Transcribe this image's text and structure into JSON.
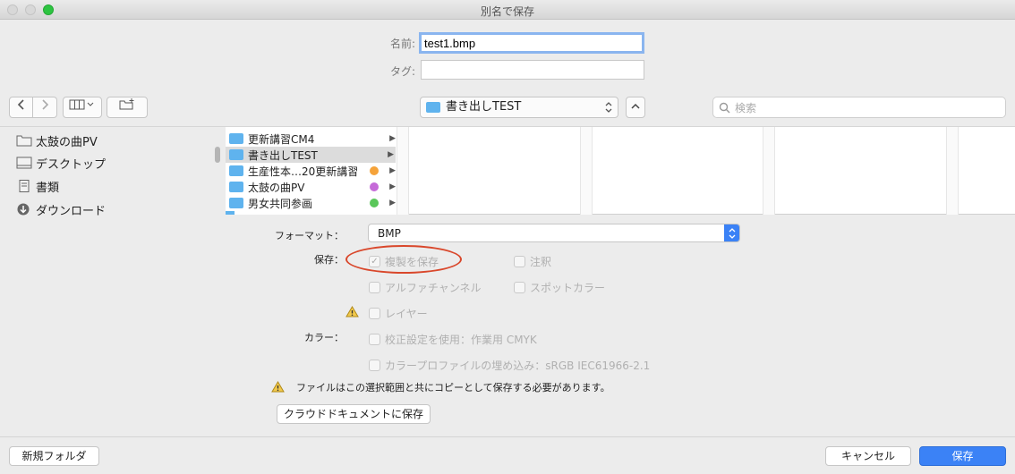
{
  "window": {
    "title": "別名で保存"
  },
  "form": {
    "name_label": "名前:",
    "name_value": "test1.bmp",
    "tag_label": "タグ:",
    "tag_value": ""
  },
  "toolbar": {
    "location": "書き出しTEST",
    "search_placeholder": "検索"
  },
  "sidebar": {
    "items": [
      {
        "label": "太鼓の曲PV",
        "icon": "folder-icon"
      },
      {
        "label": "デスクトップ",
        "icon": "desktop-icon"
      },
      {
        "label": "書類",
        "icon": "document-icon"
      },
      {
        "label": "ダウンロード",
        "icon": "download-icon"
      }
    ]
  },
  "column1": {
    "rows": [
      {
        "label": "更新講習CM4",
        "tag": null,
        "selected": false
      },
      {
        "label": "書き出しTEST",
        "tag": null,
        "selected": true
      },
      {
        "label": "生産性本…20更新講習",
        "tag": "#f5a33a",
        "selected": false
      },
      {
        "label": "太鼓の曲PV",
        "tag": "#c56ad8",
        "selected": false
      },
      {
        "label": "男女共同参画",
        "tag": "#5ac75a",
        "selected": false
      }
    ]
  },
  "options": {
    "format_label": "フォーマット：",
    "format_value": "BMP",
    "save_label": "保存：",
    "color_label": "カラー：",
    "duplicate": "複製を保存",
    "annotation": "注釈",
    "alpha": "アルファチャンネル",
    "spot": "スポットカラー",
    "layers": "レイヤー",
    "proof": "校正設定を使用：作業用 CMYK",
    "profile": "カラープロファイルの埋め込み：sRGB IEC61966-2.1",
    "warning": "ファイルはこの選択範囲と共にコピーとして保存する必要があります。",
    "cloud_button": "クラウドドキュメントに保存"
  },
  "footer": {
    "new_folder": "新規フォルダ",
    "cancel": "キャンセル",
    "save": "保存"
  },
  "colors": {
    "accent": "#3b82f6",
    "highlight_circle": "#d9472b",
    "folder": "#5fb3ee"
  }
}
